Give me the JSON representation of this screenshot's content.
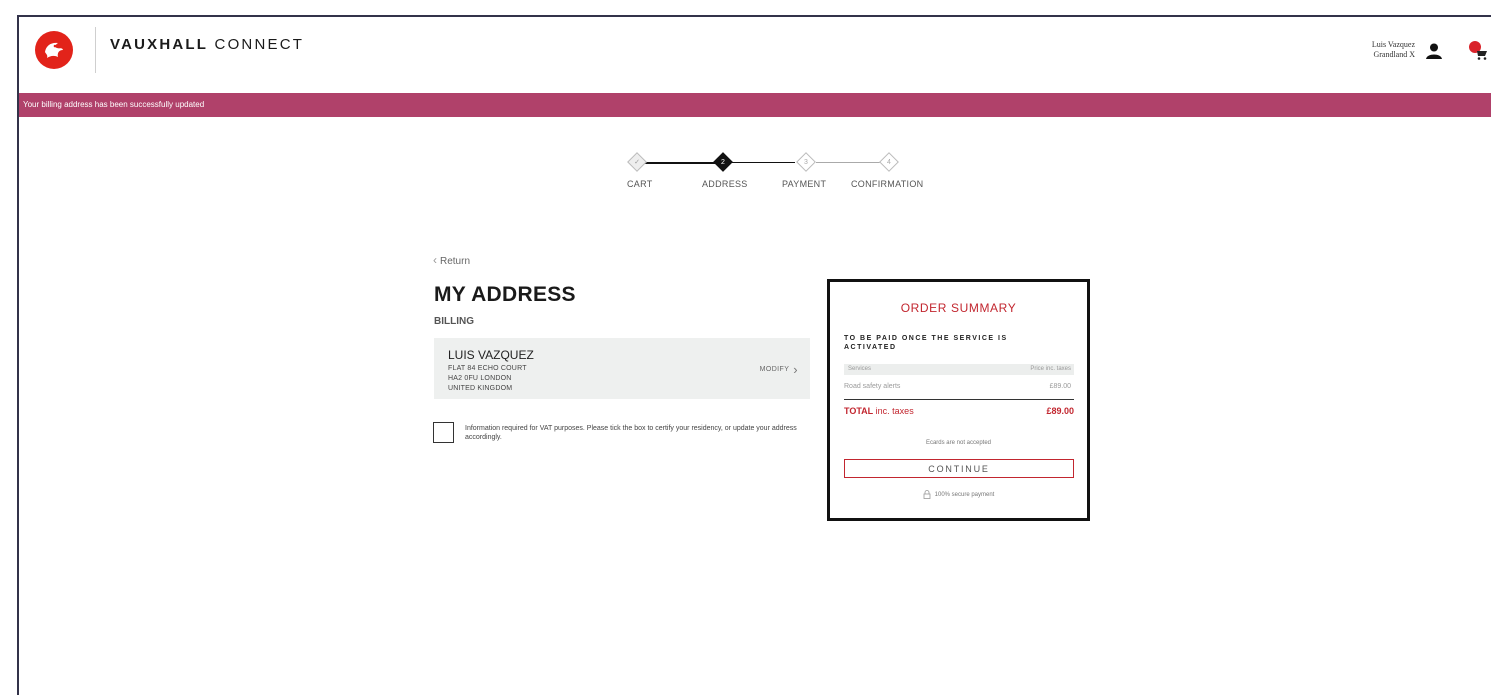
{
  "header": {
    "brand_bold": "VAUXHALL",
    "brand_light": "CONNECT",
    "user_name": "Luis Vazquez",
    "vehicle": "Grandland X"
  },
  "banner": {
    "message": "Your billing address has been successfully updated"
  },
  "stepper": {
    "steps": [
      {
        "label": "CART",
        "marker": "✓",
        "state": "done"
      },
      {
        "label": "ADDRESS",
        "marker": "2",
        "state": "current"
      },
      {
        "label": "PAYMENT",
        "marker": "3",
        "state": "upcoming"
      },
      {
        "label": "CONFIRMATION",
        "marker": "4",
        "state": "upcoming"
      }
    ]
  },
  "address_page": {
    "return_label": "Return",
    "title": "MY ADDRESS",
    "section": "BILLING",
    "billing": {
      "name": "LUIS VAZQUEZ",
      "line1": "FLAT 84 ECHO COURT",
      "line2": "HA2 0FU LONDON",
      "line3": "UNITED KINGDOM",
      "modify_label": "MODIFY"
    },
    "vat_notice": "Information required for VAT purposes. Please tick the box to certify your residency, or update your address accordingly.",
    "vat_checked": false
  },
  "summary": {
    "title": "ORDER SUMMARY",
    "subtitle": "TO BE PAID ONCE THE SERVICE IS ACTIVATED",
    "col_services": "Services",
    "col_price": "Price inc. taxes",
    "items": [
      {
        "name": "Road safety alerts",
        "price": "£89.00"
      }
    ],
    "total_label_bold": "TOTAL",
    "total_label_rest": " inc. taxes",
    "total_value": "£89.00",
    "ecards_note": "Ecards are not accepted",
    "continue_label": "CONTINUE",
    "secure_note": "100% secure payment"
  },
  "colors": {
    "accent_red": "#c2262f",
    "banner": "#b0416a",
    "brand_red": "#e2231a"
  }
}
